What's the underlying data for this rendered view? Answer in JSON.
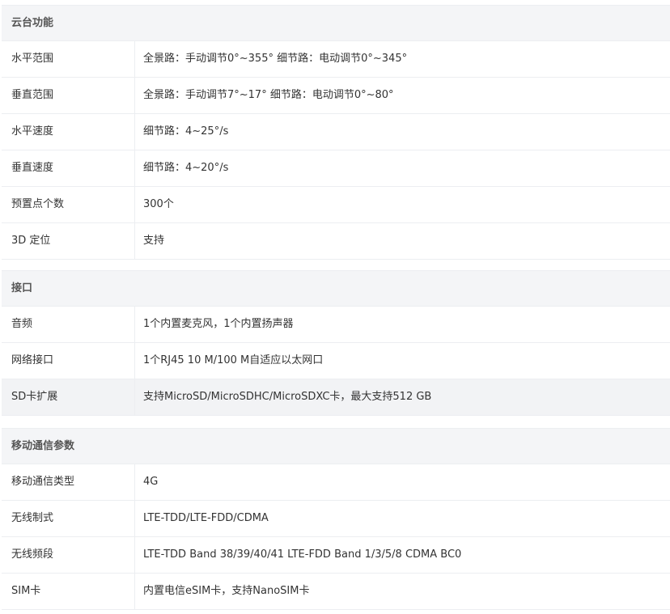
{
  "sections": [
    {
      "title": "云台功能",
      "rows": [
        {
          "label": "水平范围",
          "value": "全景路：手动调节0°~355° 细节路：电动调节0°~345°"
        },
        {
          "label": "垂直范围",
          "value": "全景路：手动调节7°~17° 细节路：电动调节0°~80°"
        },
        {
          "label": "水平速度",
          "value": "细节路：4~25°/s"
        },
        {
          "label": "垂直速度",
          "value": "细节路：4~20°/s"
        },
        {
          "label": "预置点个数",
          "value": "300个"
        },
        {
          "label": "3D 定位",
          "value": "支持"
        }
      ]
    },
    {
      "title": "接口",
      "rows": [
        {
          "label": "音频",
          "value": "1个内置麦克风，1个内置扬声器"
        },
        {
          "label": "网络接口",
          "value": "1个RJ45 10 M/100 M自适应以太网口"
        },
        {
          "label": "SD卡扩展",
          "value": "支持MicroSD/MicroSDHC/MicroSDXC卡，最大支持512 GB"
        }
      ]
    },
    {
      "title": "移动通信参数",
      "rows": [
        {
          "label": "移动通信类型",
          "value": "4G"
        },
        {
          "label": "无线制式",
          "value": "LTE-TDD/LTE-FDD/CDMA"
        },
        {
          "label": "无线频段",
          "value": "LTE-TDD Band 38/39/40/41 LTE-FDD Band 1/3/5/8 CDMA BC0"
        },
        {
          "label": "SIM卡",
          "value": "内置电信eSIM卡，支持NanoSIM卡"
        }
      ]
    }
  ]
}
